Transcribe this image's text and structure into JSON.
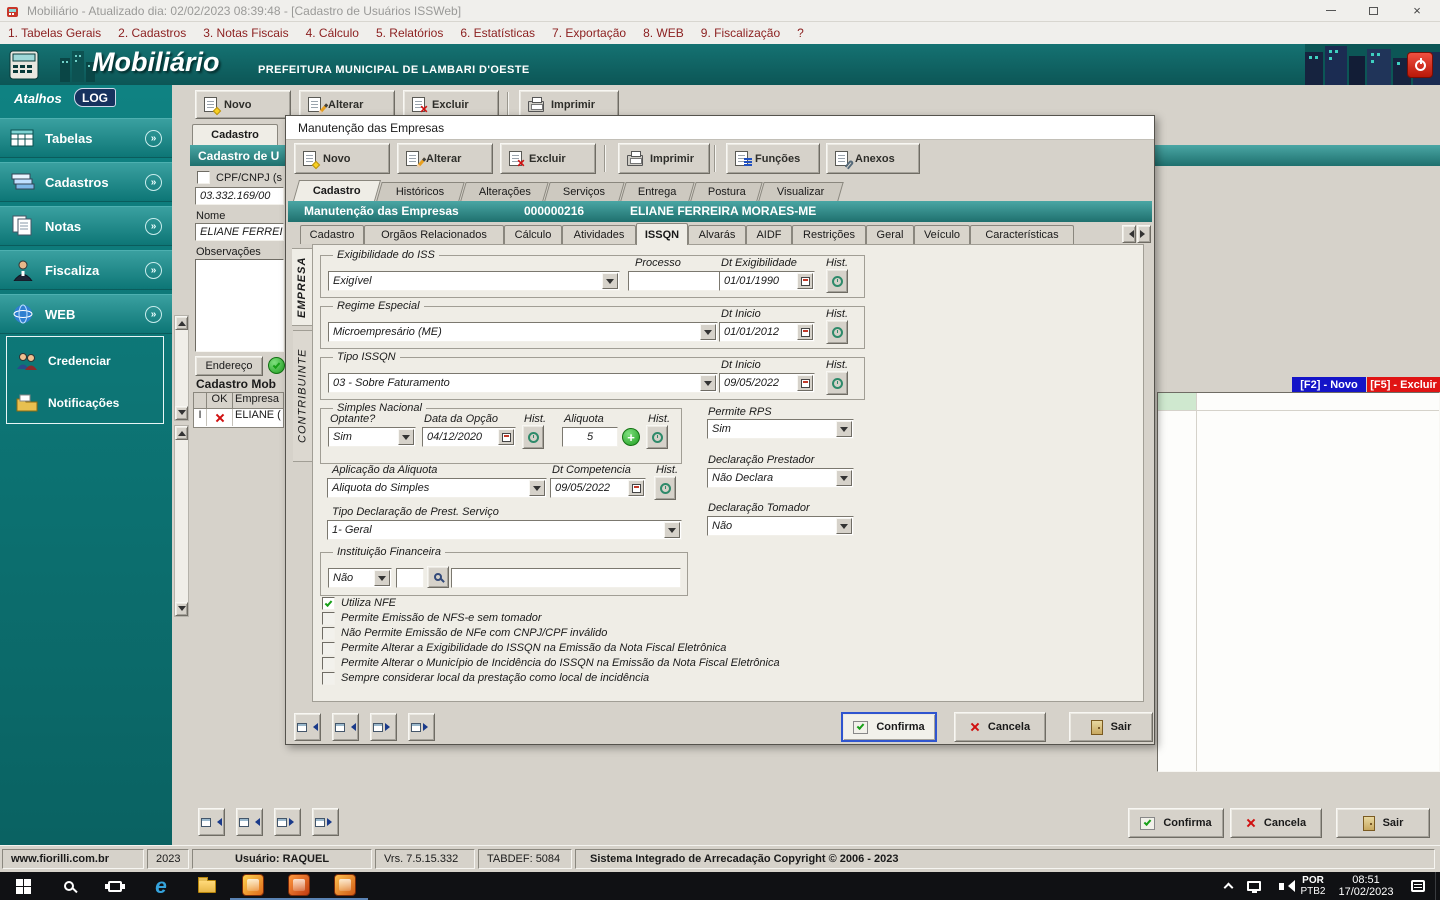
{
  "titlebar": {
    "title": "Mobiliário - Atualizado dia: 02/02/2023 08:39:48 - [Cadastro de Usuários ISSWeb]"
  },
  "menubar": {
    "items": [
      "1. Tabelas Gerais",
      "2. Cadastros",
      "3. Notas Fiscais",
      "4. Cálculo",
      "5. Relatórios",
      "6. Estatísticas",
      "7. Exportação",
      "8. WEB",
      "9. Fiscalização",
      "?"
    ]
  },
  "header": {
    "app_name": "Mobiliário",
    "municipality": "PREFEITURA MUNICIPAL DE LAMBARI D'OESTE"
  },
  "sidebar": {
    "title": "Atalhos",
    "log_badge": "LOG",
    "items": [
      {
        "label": "Tabelas"
      },
      {
        "label": "Cadastros"
      },
      {
        "label": "Notas"
      },
      {
        "label": "Fiscaliza"
      },
      {
        "label": "WEB"
      }
    ],
    "web_items": [
      {
        "label": "Credenciar"
      },
      {
        "label": "Notificações"
      }
    ]
  },
  "main": {
    "toolbar": {
      "novo": "Novo",
      "alterar": "Alterar",
      "excluir": "Excluir",
      "imprimir": "Imprimir"
    },
    "tab": "Cadastro",
    "section_title": "Cadastro de U",
    "cpf_label": "CPF/CNPJ (s",
    "cpf_value": "03.332.169/00",
    "nome_label": "Nome",
    "nome_value": "ELIANE FERREI",
    "obs_label": "Observações",
    "endereco_button": "Endereço",
    "grid_title": "Cadastro Mob",
    "grid": {
      "col_ok": "OK",
      "col_empresa": "Empresa",
      "row_status": "I",
      "row_flag_icon": "red-x",
      "row_name": "ELIANE ("
    },
    "hotkeys": {
      "f2": "[F2] - Novo",
      "f5": "[F5] - Excluir"
    },
    "footer": {
      "confirma": "Confirma",
      "cancela": "Cancela",
      "sair": "Sair"
    }
  },
  "modal": {
    "title": "Manutenção das Empresas",
    "toolbar": {
      "novo": "Novo",
      "alterar": "Alterar",
      "excluir": "Excluir",
      "imprimir": "Imprimir",
      "funcoes": "Funções",
      "anexos": "Anexos"
    },
    "tabs_top": [
      "Cadastro",
      "Históricos",
      "Alterações",
      "Serviços",
      "Entrega",
      "Postura",
      "Visualizar"
    ],
    "record_bar": {
      "title": "Manutenção das Empresas",
      "code": "000000216",
      "name": "ELIANE FERREIRA MORAES-ME"
    },
    "tabs_inner": [
      "Cadastro",
      "Orgãos Relacionados",
      "Cálculo",
      "Atividades",
      "ISSQN",
      "Alvarás",
      "AIDF",
      "Restrições",
      "Geral",
      "Veículo",
      "Características"
    ],
    "side_tabs": [
      "EMPRESA",
      "CONTRIBUINTE"
    ],
    "form": {
      "exigibilidade": {
        "legend": "Exigibilidade do ISS",
        "value": "Exigível",
        "processo_label": "Processo",
        "dt_label": "Dt Exigibilidade",
        "dt_value": "01/01/1990",
        "hist_label": "Hist."
      },
      "regime": {
        "legend": "Regime Especial",
        "value": "Microempresário (ME)",
        "dt_label": "Dt Inicio",
        "dt_value": "01/01/2012",
        "hist_label": "Hist."
      },
      "tipo_issqn": {
        "legend": "Tipo ISSQN",
        "value": "03 - Sobre Faturamento",
        "dt_label": "Dt Inicio",
        "dt_value": "09/05/2022",
        "hist_label": "Hist."
      },
      "simples": {
        "legend": "Simples Nacional",
        "optante_label": "Optante?",
        "optante_value": "Sim",
        "data_label": "Data da Opção",
        "data_value": "04/12/2020",
        "hist_label": "Hist.",
        "aliquota_label": "Aliquota",
        "aliquota_value": "5",
        "hist2_label": "Hist."
      },
      "permite_rps": {
        "label": "Permite RPS",
        "value": "Sim"
      },
      "aplicacao": {
        "label": "Aplicação da Aliquota",
        "value": "Aliquota do Simples",
        "dt_label": "Dt Competencia",
        "dt_value": "09/05/2022",
        "hist_label": "Hist."
      },
      "decl_prestador": {
        "label": "Declaração Prestador",
        "value": "Não Declara"
      },
      "tipo_decl": {
        "label": "Tipo Declaração de Prest. Serviço",
        "value": "1- Geral"
      },
      "decl_tomador": {
        "label": "Declaração Tomador",
        "value": "Não"
      },
      "inst_fin": {
        "legend": "Instituição Financeira",
        "value": "Não"
      },
      "checkboxes": [
        {
          "label": "Utiliza NFE",
          "checked": true
        },
        {
          "label": "Permite Emissão de NFS-e sem tomador",
          "checked": false
        },
        {
          "label": "Não Permite Emissão de NFe com CNPJ/CPF inválido",
          "checked": false
        },
        {
          "label": "Permite Alterar a Exigibilidade do ISSQN na Emissão da Nota Fiscal Eletrônica",
          "checked": false
        },
        {
          "label": "Permite Alterar o Município de Incidência do ISSQN na Emissão da Nota Fiscal Eletrônica",
          "checked": false
        },
        {
          "label": "Sempre considerar local da prestação como local de incidência",
          "checked": false
        }
      ]
    },
    "footer": {
      "confirma": "Confirma",
      "cancela": "Cancela",
      "sair": "Sair"
    }
  },
  "statusbar": {
    "site": "www.fiorilli.com.br",
    "year": "2023",
    "user": "Usuário: RAQUEL",
    "version": "Vrs. 7.5.15.332",
    "tabdef": "TABDEF: 5084",
    "copyright": "Sistema Integrado de Arrecadação Copyright © 2006 - 2023"
  },
  "taskbar": {
    "lang1": "POR",
    "lang2": "PTB2",
    "time": "08:51",
    "date": "17/02/2023"
  }
}
